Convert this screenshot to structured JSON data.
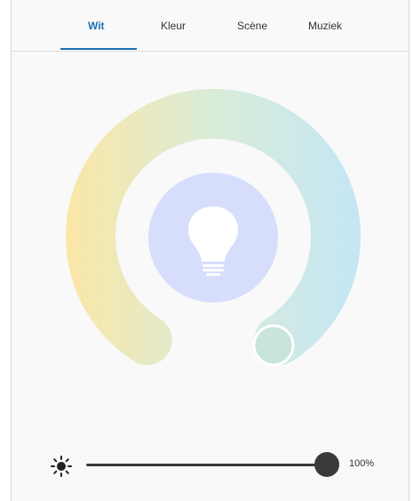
{
  "tabs": [
    {
      "label": "Wit",
      "active": true
    },
    {
      "label": "Kleur",
      "active": false
    },
    {
      "label": "Scène",
      "active": false
    },
    {
      "label": "Muziek",
      "active": false
    }
  ],
  "color_temperature": {
    "warm_color": "#fbe6a6",
    "mid_color": "#d9ecd8",
    "cool_color": "#c4e6f5",
    "selected_color": "#c8e4dc",
    "bulb_background": "#d6defc",
    "bulb_icon": "lightbulb-icon"
  },
  "brightness": {
    "icon": "sun-icon",
    "value": 1.0,
    "label": "100%"
  },
  "colors": {
    "accent": "#1e6fb3",
    "slider": "#3a3a3a"
  }
}
